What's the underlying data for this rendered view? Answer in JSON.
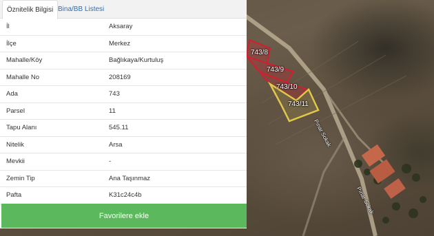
{
  "tabs": [
    {
      "label": "Öznitelik Bilgisi",
      "active": true
    },
    {
      "label": "Bina/BB Listesi",
      "active": false
    }
  ],
  "attributes": [
    {
      "label": "İl",
      "value": "Aksaray"
    },
    {
      "label": "İlçe",
      "value": "Merkez"
    },
    {
      "label": "Mahalle/Köy",
      "value": "Bağlıkaya/Kurtuluş"
    },
    {
      "label": "Mahalle No",
      "value": "208169"
    },
    {
      "label": "Ada",
      "value": "743"
    },
    {
      "label": "Parsel",
      "value": "11"
    },
    {
      "label": "Tapu Alanı",
      "value": "545.11"
    },
    {
      "label": "Nitelik",
      "value": "Arsa"
    },
    {
      "label": "Mevkii",
      "value": "-"
    },
    {
      "label": "Zemin Tip",
      "value": "Ana Taşınmaz"
    },
    {
      "label": "Pafta",
      "value": "K31c24c4b"
    }
  ],
  "favorite_button": "Favorilere ekle",
  "map": {
    "parcels": [
      "743/8",
      "743/9",
      "743/10",
      "743/11"
    ],
    "road_labels": [
      "Pınar Sokak",
      "Pınar Sokak"
    ],
    "colors": {
      "parcel_outline": "#d01f2f",
      "selected_outline": "#e0c84a",
      "button_green": "#5cb85c",
      "tab_link": "#2a6ebb"
    }
  }
}
